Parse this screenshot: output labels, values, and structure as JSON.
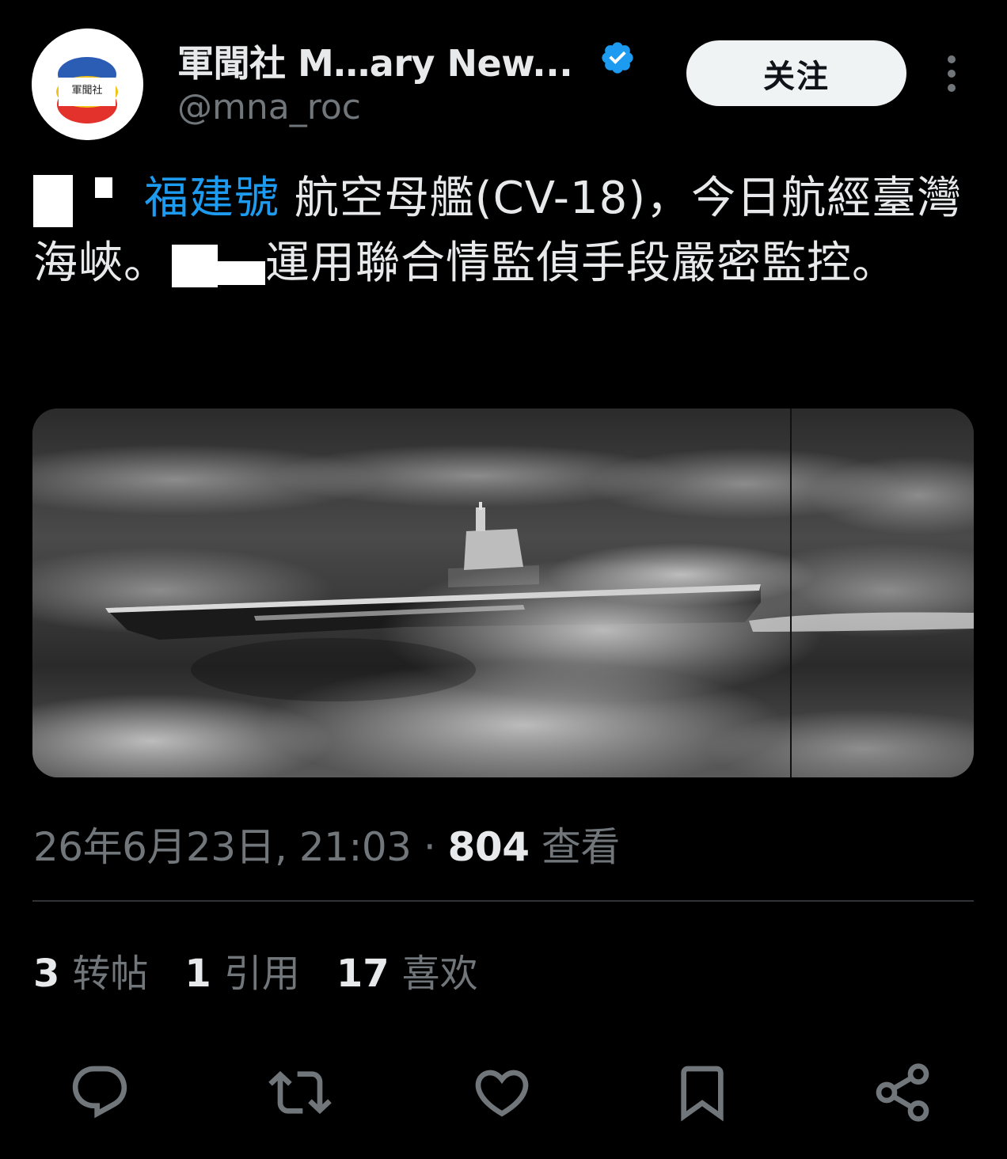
{
  "author": {
    "display_name": "軍聞社 M…ary New...",
    "handle": "@mna_roc",
    "avatar_text": "軍聞社",
    "verified": true,
    "verified_color": "#1d9bf0"
  },
  "header": {
    "follow_label": "关注",
    "more_icon": "more-vertical-icon"
  },
  "tweet": {
    "text_part1": "福建號",
    "text_part2": " 航空母艦(CV-18)，今日航經臺灣海峽。",
    "text_part3": "運用聯合情監偵手段嚴密監控。",
    "hashtag_color": "#1d9bf0"
  },
  "media": {
    "description_icon": "photo-carrier-icon"
  },
  "meta": {
    "datetime": "26年6月23日, 21:03",
    "separator": " · ",
    "views_count": "804",
    "views_label": " 查看"
  },
  "stats": {
    "retweets_count": "3",
    "retweets_label": "转帖",
    "quotes_count": "1",
    "quotes_label": "引用",
    "likes_count": "17",
    "likes_label": "喜欢"
  },
  "actions": [
    {
      "icon": "reply-icon"
    },
    {
      "icon": "retweet-icon"
    },
    {
      "icon": "like-icon"
    },
    {
      "icon": "bookmark-icon"
    },
    {
      "icon": "share-icon"
    }
  ],
  "colors": {
    "background": "#000000",
    "text_primary": "#e7e9ea",
    "text_secondary": "#71767b",
    "accent": "#1d9bf0"
  }
}
